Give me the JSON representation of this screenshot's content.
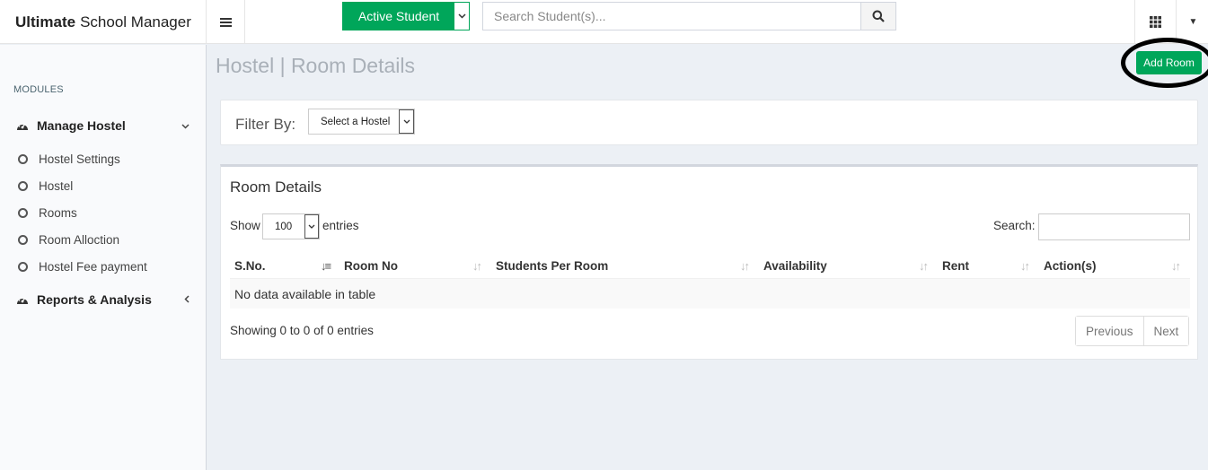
{
  "brand": {
    "bold": "Ultimate",
    "rest": "School Manager"
  },
  "header": {
    "active_student_label": "Active Student",
    "search_placeholder": "Search Student(s)..."
  },
  "sidebar": {
    "section_label": "MODULES",
    "groups": [
      {
        "label": "Manage Hostel",
        "expanded": true,
        "items": [
          {
            "label": "Hostel Settings"
          },
          {
            "label": "Hostel"
          },
          {
            "label": "Rooms"
          },
          {
            "label": "Room Alloction"
          },
          {
            "label": "Hostel Fee payment"
          }
        ]
      },
      {
        "label": "Reports & Analysis",
        "expanded": false
      }
    ]
  },
  "page": {
    "title": "Hostel | Room Details",
    "add_button": "Add Room"
  },
  "filter": {
    "label": "Filter By:",
    "select_value": "Select a Hostel"
  },
  "room_box": {
    "title": "Room Details",
    "show_label": "Show",
    "entries_value": "100",
    "entries_label": "entries",
    "search_label": "Search:",
    "columns": [
      "S.No.",
      "Room No",
      "Students Per Room",
      "Availability",
      "Rent",
      "Action(s)"
    ],
    "empty_message": "No data available in table",
    "info": "Showing 0 to 0 of 0 entries",
    "prev_label": "Previous",
    "next_label": "Next"
  },
  "colors": {
    "accent_green": "#00a65a",
    "content_bg": "#ecf0f5",
    "sidebar_bg": "#f9fafc"
  }
}
